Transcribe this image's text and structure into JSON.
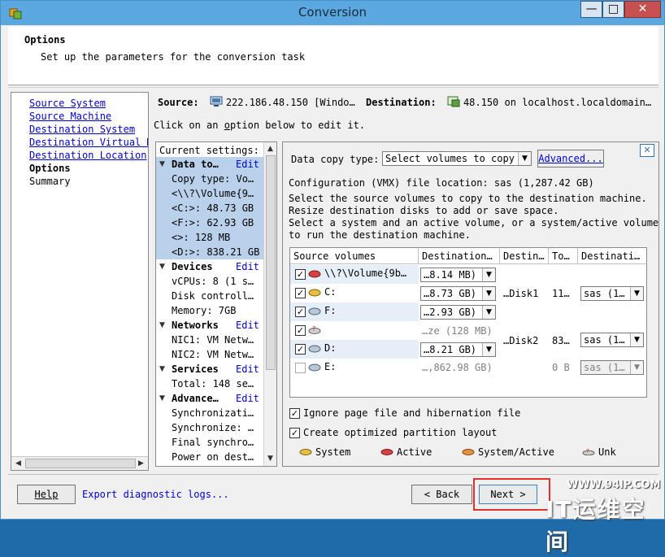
{
  "window": {
    "title": "Conversion",
    "min": "—",
    "max": "□",
    "close": "✕"
  },
  "header": {
    "title": "Options",
    "subtitle": "Set up the parameters for the conversion task"
  },
  "nav": {
    "items": [
      {
        "label": "Source System",
        "style": "link"
      },
      {
        "label": "Source Machine",
        "style": "link"
      },
      {
        "label": "Destination System",
        "style": "link"
      },
      {
        "label": "Destination Virtual M",
        "style": "link"
      },
      {
        "label": "Destination Location",
        "style": "link"
      },
      {
        "label": "Options",
        "style": "bold"
      },
      {
        "label": "Summary",
        "style": "plain"
      }
    ]
  },
  "source": {
    "label": "Source:",
    "value": "222.186.48.150 [Windo…",
    "dest_label": "Destination:",
    "dest_value": "48.150 on localhost.localdomain…"
  },
  "instruction": {
    "pre": "Click on an ",
    "link": "o",
    "post": "ption below to edit it."
  },
  "settings": {
    "header": "Current settings:",
    "edit_label": "Edit",
    "sections": [
      {
        "label": "Data to…",
        "values": [
          "Copy type: Vo…",
          "<\\\\?\\Volume{9…",
          "<C:>: 48.73 GB",
          "<F:>: 62.93 GB",
          "<>: 128 MB",
          "<D:>: 838.21 GB"
        ]
      },
      {
        "label": "Devices",
        "values": [
          "vCPUs: 8 (1 s…",
          "Disk controll…",
          "Memory: 7GB"
        ]
      },
      {
        "label": "Networks",
        "values": [
          "NIC1: VM Netw…",
          "NIC2: VM Netw…"
        ]
      },
      {
        "label": "Services",
        "values": [
          "Total: 148 se…"
        ]
      },
      {
        "label": "Advance…",
        "values": [
          "Synchronizati…",
          "Synchronize: …",
          "Final synchro…",
          "Power on dest…"
        ]
      }
    ]
  },
  "data_copy": {
    "type_label": "Data copy type:",
    "type_value": "Select volumes to copy",
    "advanced_label": "Advanced...",
    "config_location": "Configuration (VMX) file location: sas (1,287.42 GB)",
    "instructions": [
      "Select the source volumes to copy to the destination machine.",
      "Resize destination disks to add or save space.",
      "Select a system and an active volume, or a system/active volume",
      "to run the destination machine."
    ],
    "table": {
      "headers": [
        "Source volumes",
        "Destination…",
        "Destin…",
        "To…",
        "Destinati…"
      ],
      "volumes": [
        {
          "name": "\\\\?\\Volume{9b…",
          "size": "…8.14 MB)",
          "checked": true,
          "icon": "active"
        },
        {
          "name": "C:",
          "size": "…8.73 GB)",
          "checked": true,
          "icon": "system"
        },
        {
          "name": "F:",
          "size": "…2.93 GB)",
          "checked": true,
          "icon": "normal"
        },
        {
          "name": "",
          "size": "…ze (128 MB)",
          "checked": true,
          "icon": "unknown"
        },
        {
          "name": "D:",
          "size": "…8.21 GB)",
          "checked": true,
          "icon": "normal"
        },
        {
          "name": "E:",
          "size": "…,862.98 GB)",
          "checked": false,
          "icon": "normal"
        }
      ],
      "disks": [
        {
          "name": "…Disk1",
          "total": "11…",
          "datastore": "sas (1…"
        },
        {
          "name": "…Disk2",
          "total": "83…",
          "datastore": "sas (1…"
        },
        {
          "name": "",
          "total": "0 B",
          "datastore": "sas (1…"
        }
      ]
    },
    "ignore_pagefile": "Ignore page file and hibernation file",
    "optimized_layout": "Create optimized partition layout",
    "legend": [
      "System",
      "Active",
      "System/Active",
      "Unk"
    ]
  },
  "footer": {
    "help": "Help",
    "export": "Export diagnostic logs...",
    "back": "< Back",
    "next": "Next >"
  },
  "watermark": {
    "url": "WWW.94IP.COM",
    "text": "IT运维空间"
  },
  "colors": {
    "titlebar": "#5ba7e0",
    "highlight": "#b9d1ea",
    "link": "#0000cc",
    "annotation": "#e03030"
  }
}
